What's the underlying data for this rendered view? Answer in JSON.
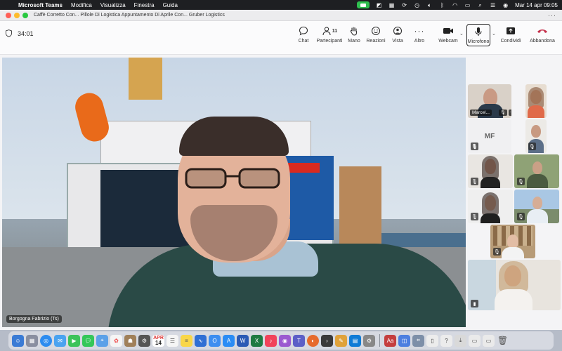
{
  "menubar": {
    "apple_glyph": "",
    "app_name": "Microsoft Teams",
    "menus": [
      "Modifica",
      "Visualizza",
      "Finestra",
      "Guida"
    ],
    "datetime": "Mar 14 apr  09:05"
  },
  "window": {
    "title": "Caffè Corretto Con... Pillole Di Logistica Appuntamento Di Aprile Con... Gruber Logistics",
    "more": "···"
  },
  "toolbar": {
    "timer": "34:01",
    "chat": "Chat",
    "participants": "Partecipanti",
    "participants_count": "11",
    "hand": "Mano",
    "reactions": "Reazioni",
    "view": "Vista",
    "more": "Altro",
    "webcam": "Webcam",
    "mic": "Microfono",
    "share": "Condividi",
    "leave": "Abbandona",
    "leave_color": "#c4314b"
  },
  "main_video": {
    "name": "Borgogna Fabrizio (Ts)"
  },
  "gallery": {
    "tiles": [
      {
        "name": "Marcel..."
      },
      {
        "initials": "MF"
      }
    ]
  },
  "dock": {
    "calendar_month": "APR",
    "calendar_day": "14"
  }
}
